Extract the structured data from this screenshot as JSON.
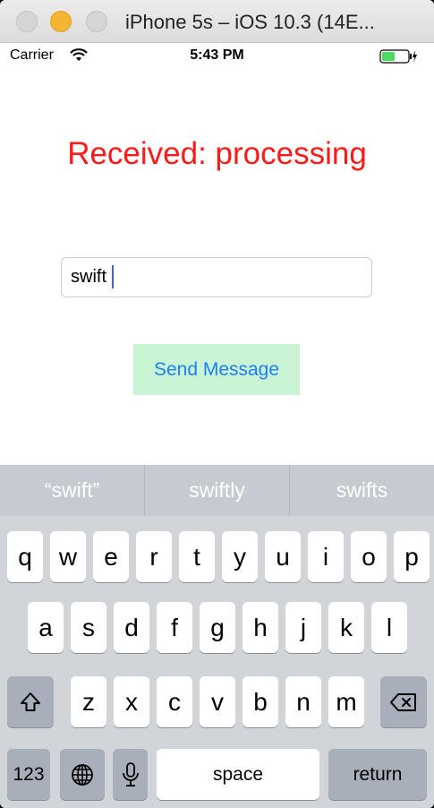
{
  "window": {
    "title": "iPhone 5s – iOS 10.3 (14E..."
  },
  "status_bar": {
    "carrier": "Carrier",
    "time": "5:43 PM"
  },
  "app": {
    "received_label": "Received: processing",
    "input_value": "swift",
    "send_button_label": "Send Message",
    "accent_color": "#ff1a1a",
    "button_color": "#c9f5d5"
  },
  "keyboard": {
    "suggestions": [
      "“swift”",
      "swiftly",
      "swifts"
    ],
    "row1": [
      "q",
      "w",
      "e",
      "r",
      "t",
      "y",
      "u",
      "i",
      "o",
      "p"
    ],
    "row2": [
      "a",
      "s",
      "d",
      "f",
      "g",
      "h",
      "j",
      "k",
      "l"
    ],
    "row3": [
      "z",
      "x",
      "c",
      "v",
      "b",
      "n",
      "m"
    ],
    "numbers_label": "123",
    "space_label": "space",
    "return_label": "return"
  },
  "icons": [
    "wifi-icon",
    "battery-charging-icon",
    "shift-icon",
    "delete-icon",
    "globe-icon",
    "microphone-icon"
  ]
}
